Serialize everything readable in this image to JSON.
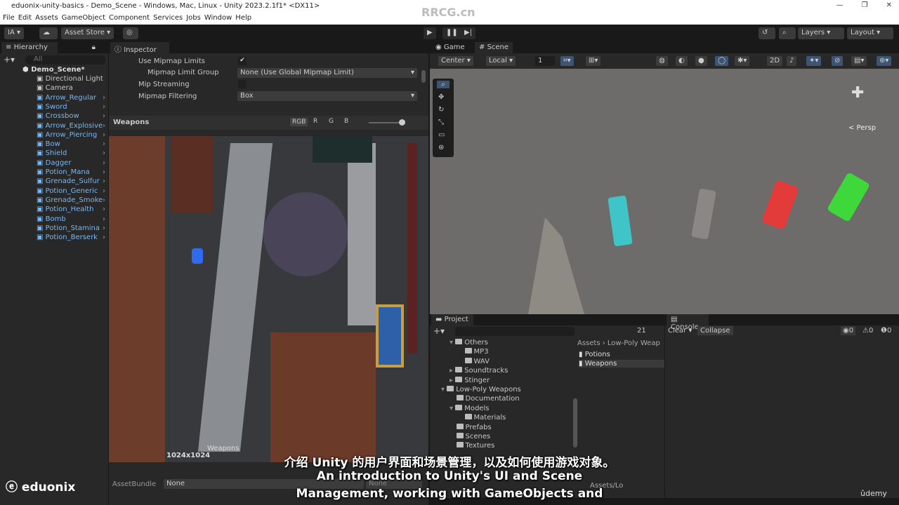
{
  "window": {
    "title": "eduonix-unity-basics - Demo_Scene - Windows, Mac, Linux - Unity 2023.2.1f1* <DX11>",
    "controls": [
      "—",
      "❐",
      "✕"
    ]
  },
  "menu": [
    "File",
    "Edit",
    "Assets",
    "GameObject",
    "Component",
    "Services",
    "Jobs",
    "Window",
    "Help"
  ],
  "toolbar": {
    "account": "IA ▾",
    "asset_store": "Asset Store ▾",
    "layers": "Layers",
    "layout": "Layout"
  },
  "hierarchy": {
    "title": "Hierarchy",
    "search_placeholder": "All",
    "scene": "Demo_Scene*",
    "items": [
      {
        "label": "Directional Light",
        "prefab": false
      },
      {
        "label": "Camera",
        "prefab": false
      },
      {
        "label": "Arrow_Regular",
        "prefab": true
      },
      {
        "label": "Sword",
        "prefab": true
      },
      {
        "label": "Crossbow",
        "prefab": true
      },
      {
        "label": "Arrow_Explosive",
        "prefab": true
      },
      {
        "label": "Arrow_Piercing",
        "prefab": true
      },
      {
        "label": "Bow",
        "prefab": true
      },
      {
        "label": "Shield",
        "prefab": true
      },
      {
        "label": "Dagger",
        "prefab": true
      },
      {
        "label": "Potion_Mana",
        "prefab": true
      },
      {
        "label": "Grenade_Sulfur",
        "prefab": true
      },
      {
        "label": "Potion_Generic",
        "prefab": true
      },
      {
        "label": "Grenade_Smoke",
        "prefab": true
      },
      {
        "label": "Potion_Health",
        "prefab": true
      },
      {
        "label": "Bomb",
        "prefab": true
      },
      {
        "label": "Potion_Stamina",
        "prefab": true
      },
      {
        "label": "Potion_Berserk",
        "prefab": true
      }
    ]
  },
  "inspector": {
    "title": "Inspector",
    "fields": [
      {
        "label": "Use Mipmap Limits",
        "checked": true
      },
      {
        "label": "Mipmap Limit Group",
        "value": "None (Use Global Mipmap Limit)"
      },
      {
        "label": "Mip Streaming",
        "checked": false
      },
      {
        "label": "Mipmap Filtering",
        "value": "Box"
      }
    ],
    "preview": {
      "name": "Weapons",
      "channels": [
        "RGB",
        "R",
        "G",
        "B"
      ],
      "size": "1024x1024",
      "caption": "Weapons"
    },
    "assetbundle": {
      "label": "AssetBundle",
      "value": "None",
      "variant": "None"
    }
  },
  "scene": {
    "tabs": [
      "Game",
      "Scene"
    ],
    "pivot": "Center",
    "space": "Local",
    "grid": "1",
    "mode_2d": "2D",
    "persp": "< Persp"
  },
  "project": {
    "title": "Project",
    "hidden_count": "21",
    "breadcrumb": [
      "Assets",
      "Low-Poly Weap"
    ],
    "tree": [
      {
        "label": "Others",
        "depth": 1,
        "open": true
      },
      {
        "label": "MP3",
        "depth": 2
      },
      {
        "label": "WAV",
        "depth": 2
      },
      {
        "label": "Soundtracks",
        "depth": 1,
        "arrow": true
      },
      {
        "label": "Stinger",
        "depth": 1,
        "arrow": true
      },
      {
        "label": "Low-Poly Weapons",
        "depth": 0,
        "open": true
      },
      {
        "label": "Documentation",
        "depth": 1
      },
      {
        "label": "Models",
        "depth": 1,
        "open": true
      },
      {
        "label": "Materials",
        "depth": 2
      },
      {
        "label": "Prefabs",
        "depth": 1
      },
      {
        "label": "Scenes",
        "depth": 1
      },
      {
        "label": "Textures",
        "depth": 1
      }
    ],
    "files": [
      "Potions",
      "Weapons"
    ],
    "footer": "Assets/Lo"
  },
  "console": {
    "title": "Console",
    "clear": "Clear",
    "collapse": "Collapse",
    "counts": [
      "0",
      "0",
      "0"
    ]
  },
  "subtitles": {
    "zh": "介绍 Unity 的用户界面和场景管理，以及如何使用游戏对象。",
    "en1": "An introduction to Unity's UI and Scene",
    "en2": "Management, working with GameObjects and"
  },
  "branding": {
    "eduonix": "eduonix",
    "watermark": "RRCG.cn",
    "udemy": "ûdemy"
  }
}
